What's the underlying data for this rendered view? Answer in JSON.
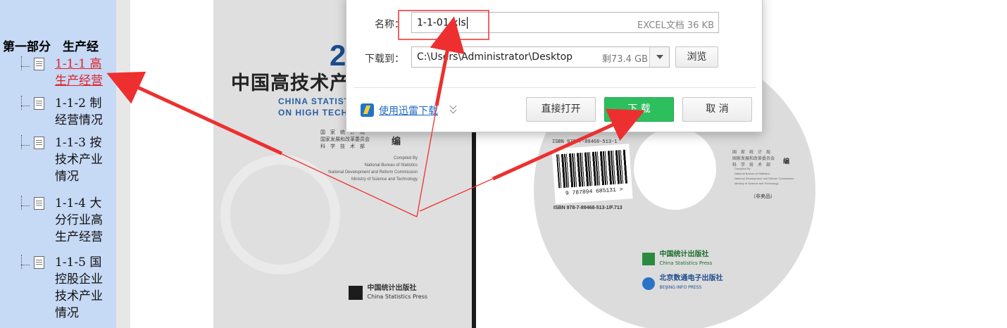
{
  "sidebar": {
    "section_title": "第一部分　生产经",
    "items": [
      {
        "label": "1-1-1 高\n生产经营",
        "active": true
      },
      {
        "label": "1-1-2 制\n经营情况",
        "active": false
      },
      {
        "label": "1-1-3 按\n技术产业\n情况",
        "active": false
      },
      {
        "label": "1-1-4 大\n分行业高\n生产经营",
        "active": false
      },
      {
        "label": "1-1-5 国\n控股企业\n技术产业\n情况",
        "active": false
      }
    ]
  },
  "cover": {
    "year_fragment": "2",
    "title_cn": "中国高技术产业",
    "title_en_line1": "CHINA STATISTI",
    "title_en_line2": "ON HIGH TECHN",
    "publishers_cn": [
      "国　家　统　计　局",
      "国家发展和改革委员会",
      "科　学　技　术　部"
    ],
    "edited_by": "编",
    "compiled_by": [
      "Compiled By",
      "National Bureau of Statistics",
      "National Development and Reform Commission",
      "Ministry of Science and Technology"
    ],
    "press_logo_cn": "中国统计出版社",
    "press_logo_en": "China Statistics Press"
  },
  "disc": {
    "isbn_top": "ISBN 978-7-89468-513-1",
    "barcode_number": "9 787894 685131 >",
    "isbn_line": "ISBN 978-7-89468-513-1/F.713",
    "publishers_cn": [
      "国　家　统　计　局",
      "国家发展和改革委员会",
      "科　学　技　术　部"
    ],
    "edited_by": "编",
    "compiled_by": [
      "Compiled By",
      "National Bureau of Statistics",
      "National Development and Reform Commission",
      "Ministry of Science and Technology"
    ],
    "not_for_sale": "（非卖品）",
    "logo1_cn": "中国统计出版社",
    "logo1_en": "China Statistics Press",
    "logo2_cn": "北京数通电子出版社",
    "logo2_en": "BEIJING INFO PRESS"
  },
  "dialog": {
    "name_label": "名称：",
    "file_name": "1-1-01.xls",
    "file_meta": "EXCEL文档 36 KB",
    "save_to_label": "下载到：",
    "save_path": "C:\\Users\\Administrator\\Desktop",
    "free_space": "剩73.4 GB",
    "browse_label": "浏览",
    "thunder_link": "使用迅雷下载",
    "open_label": "直接打开",
    "download_label": "下 载",
    "cancel_label": "取 消"
  },
  "colors": {
    "sidebar_bg": "#c6d9f5",
    "active_link": "#e0212a",
    "primary_button": "#2dbf5e",
    "annotation_red": "#ee2f2f"
  }
}
